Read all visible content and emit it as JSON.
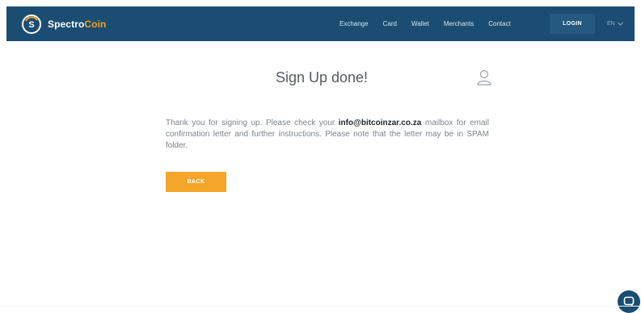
{
  "brand": {
    "name_part1": "Spectro",
    "name_part2": "Coin",
    "accent_color": "#f3a21f",
    "bar_color": "#1b4d72"
  },
  "nav": {
    "items": [
      "Exchange",
      "Card",
      "Wallet",
      "Merchants",
      "Contact"
    ],
    "login_label": "LOGIN",
    "language": "EN"
  },
  "main": {
    "title": "Sign Up done!",
    "message_before": "Thank you for signing up. Please check your ",
    "email": "info@bitcoinzar.co.za",
    "message_after": " mailbox for email confirmation letter and further instructions. Please note that the letter may be in SPAM folder.",
    "back_label": "BACK",
    "button_color": "#f3a629"
  },
  "icons": {
    "user": "user-icon",
    "chat": "chat-icon",
    "logo": "spectrocoin-logo-icon",
    "caret": "chevron-down-icon"
  }
}
